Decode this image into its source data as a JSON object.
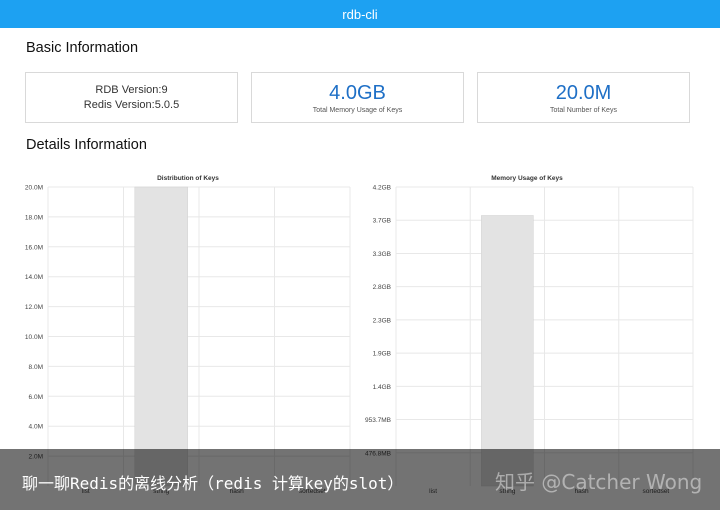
{
  "app": {
    "title": "rdb-cli"
  },
  "basic": {
    "title": "Basic Information",
    "rdb_version_label": "RDB Version:",
    "rdb_version_value": "9",
    "redis_version_label": "Redis Version:",
    "redis_version_value": "5.0.5",
    "memory_value": "4.0GB",
    "memory_label": "Total Memory Usage of Keys",
    "keys_value": "20.0M",
    "keys_label": "Total Number of Keys"
  },
  "details": {
    "title": "Details Information"
  },
  "colors": {
    "topbar": "#1da1f2",
    "big_number": "#1e6fc6",
    "bar": "#e3e3e3"
  },
  "chart_data": [
    {
      "type": "bar",
      "title": "Distribution of Keys",
      "categories": [
        "list",
        "string",
        "hash",
        "sortedset"
      ],
      "values": [
        0,
        20.0,
        0,
        0
      ],
      "ylim": [
        0,
        20.0
      ],
      "yticks": [
        "20.0M",
        "18.0M",
        "16.0M",
        "14.0M",
        "12.0M",
        "10.0M",
        "8.0M",
        "6.0M",
        "4.0M",
        "2.0M"
      ],
      "grid": true
    },
    {
      "type": "bar",
      "title": "Memory Usage of Keys",
      "categories": [
        "list",
        "string",
        "hash",
        "sortedset"
      ],
      "values": [
        0,
        3.8,
        0,
        0
      ],
      "ylim": [
        0,
        4.2
      ],
      "yticks": [
        "4.2GB",
        "3.7GB",
        "3.3GB",
        "2.8GB",
        "2.3GB",
        "1.9GB",
        "1.4GB",
        "953.7MB",
        "476.8MB"
      ],
      "grid": true
    }
  ],
  "overlay": {
    "caption": "聊一聊Redis的离线分析（redis 计算key的slot）",
    "watermark": "知乎 @Catcher Wong"
  }
}
